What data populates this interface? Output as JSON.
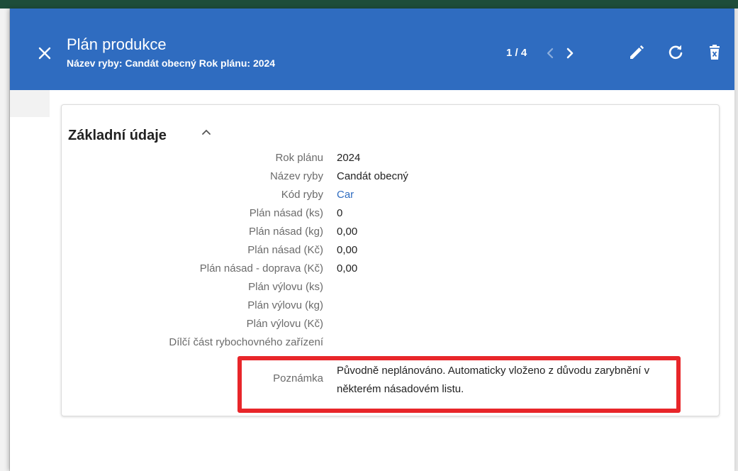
{
  "dialog": {
    "title": "Plán produkce",
    "subtitle": "Název ryby: Candát obecný Rok plánu: 2024",
    "pager": "1 / 4"
  },
  "icons": {
    "close": "close-icon",
    "prev": "chevron-left-icon",
    "next": "chevron-right-icon",
    "edit": "pencil-icon",
    "refresh": "refresh-icon",
    "delete": "delete-icon",
    "collapse": "chevron-up-icon"
  },
  "section": {
    "title": "Základní údaje"
  },
  "fields": [
    {
      "label": "Rok plánu",
      "value": "2024"
    },
    {
      "label": "Název ryby",
      "value": "Candát obecný"
    },
    {
      "label": "Kód ryby",
      "value": "Car"
    },
    {
      "label": "Plán násad (ks)",
      "value": "0"
    },
    {
      "label": "Plán násad (kg)",
      "value": "0,00"
    },
    {
      "label": "Plán násad (Kč)",
      "value": "0,00"
    },
    {
      "label": "Plán násad - doprava (Kč)",
      "value": "0,00"
    },
    {
      "label": "Plán výlovu (ks)",
      "value": ""
    },
    {
      "label": "Plán výlovu (kg)",
      "value": ""
    },
    {
      "label": "Plán výlovu (Kč)",
      "value": ""
    },
    {
      "label": "Dílčí část rybochovného zařízení",
      "value": ""
    }
  ],
  "note": {
    "label": "Poznámka",
    "value": "Původně neplánováno. Automaticky vloženo z důvodu zarybnění v některém násadovém listu."
  },
  "colors": {
    "header": "#2f6cc0",
    "link": "#2f6cc0",
    "highlight": "#e8262a"
  }
}
